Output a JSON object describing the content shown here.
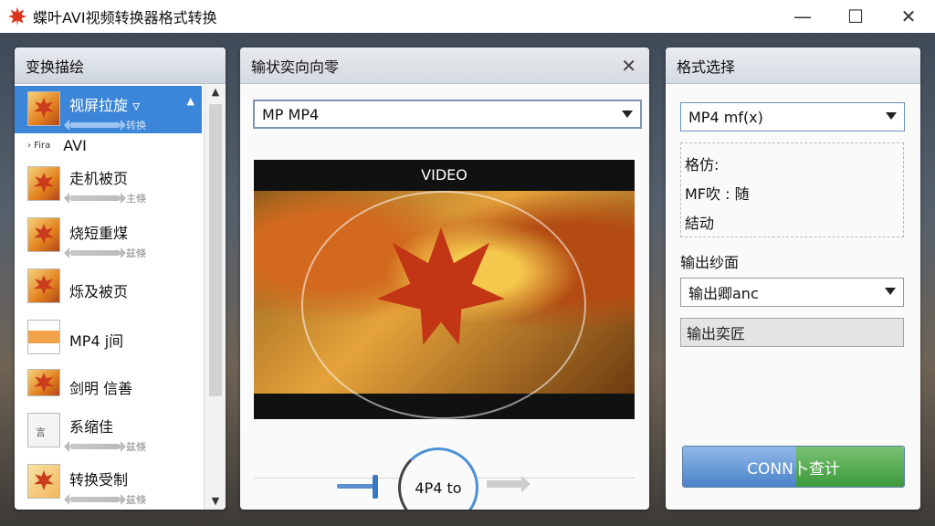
{
  "app": {
    "title": "蝶叶AVI视频转换器格式转换",
    "controls": {
      "minimize": "—",
      "maximize": "☐",
      "close": "✕"
    }
  },
  "left_panel": {
    "title": "变换描绘",
    "items": [
      {
        "label": "视屏拉旋 ▿",
        "sub": "转换"
      },
      {
        "label": "AVI",
        "prefix": "› Fira"
      },
      {
        "label": "走机被页",
        "sub": "主倏"
      },
      {
        "label": "烧短重煤",
        "sub": "兹倏"
      },
      {
        "label": "烁及被页",
        "sub": ""
      },
      {
        "label": "MP4 j间",
        "sub": ""
      },
      {
        "label": "剑明 信善",
        "sub": ""
      },
      {
        "label": "系缩佳",
        "sub": "兹倏"
      },
      {
        "label": "转换受制",
        "sub": "兹倏"
      }
    ],
    "doc_glyph": "言"
  },
  "middle_panel": {
    "title": "输状奕向向零",
    "format_select": "MP MP4",
    "video_label": "VIDEO",
    "dial_text": "4P4 to"
  },
  "right_panel": {
    "title": "格式选择",
    "format_select": "MP4 mf(x)",
    "info_lines": [
      "格仿:",
      "MF吹 : 随",
      "結动"
    ],
    "output_label": "输出纱面",
    "output_select": "输出卿anc",
    "output_field": "输出奕匠",
    "convert_button": "CONN卜查计"
  },
  "colors": {
    "selected": "#3b86d8",
    "convert_left": "#4b83c9",
    "convert_right": "#3d9a3b"
  }
}
